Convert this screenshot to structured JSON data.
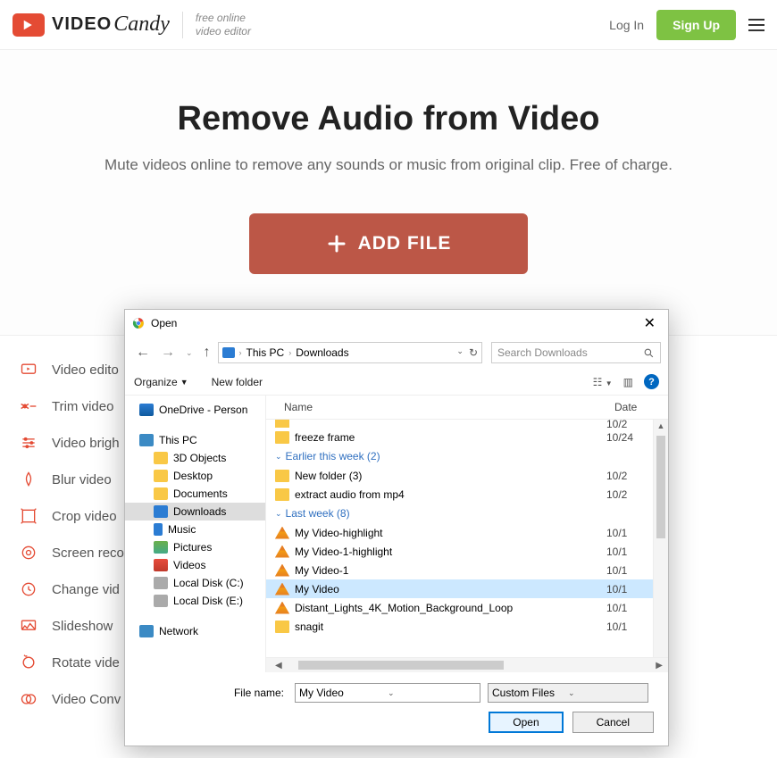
{
  "header": {
    "brand1": "VIDEO",
    "brand2": "Candy",
    "tagline1": "free online",
    "tagline2": "video editor",
    "login": "Log In",
    "signup": "Sign Up"
  },
  "hero": {
    "title": "Remove Audio from Video",
    "subtitle": "Mute videos online to remove any sounds or music from original clip. Free of charge.",
    "addfile": "ADD FILE"
  },
  "sidebar": [
    "Video edito",
    "Trim video",
    "Video brigh",
    "Blur video",
    "Crop video",
    "Screen reco",
    "Change vid",
    "Slideshow",
    "Rotate vide",
    "Video Conv"
  ],
  "dialog": {
    "title": "Open",
    "addr": {
      "root": "This PC",
      "folder": "Downloads"
    },
    "search_placeholder": "Search Downloads",
    "organize": "Organize",
    "newfolder": "New folder",
    "cols": {
      "name": "Name",
      "date": "Date"
    },
    "tree": [
      {
        "label": "OneDrive - Person",
        "cls": "l1",
        "ico": "ico-onedrive"
      },
      {
        "label": "This PC",
        "cls": "l1",
        "ico": "ico-pc"
      },
      {
        "label": "3D Objects",
        "cls": "l2",
        "ico": "ico-folder"
      },
      {
        "label": "Desktop",
        "cls": "l2",
        "ico": "ico-folder"
      },
      {
        "label": "Documents",
        "cls": "l2",
        "ico": "ico-folder"
      },
      {
        "label": "Downloads",
        "cls": "l2 sel",
        "ico": "ico-downloads"
      },
      {
        "label": "Music",
        "cls": "l2",
        "ico": "ico-music"
      },
      {
        "label": "Pictures",
        "cls": "l2",
        "ico": "ico-pics"
      },
      {
        "label": "Videos",
        "cls": "l2",
        "ico": "ico-videos"
      },
      {
        "label": "Local Disk (C:)",
        "cls": "l2",
        "ico": "ico-disk"
      },
      {
        "label": "Local Disk (E:)",
        "cls": "l2",
        "ico": "ico-disk"
      },
      {
        "label": "Network",
        "cls": "l1",
        "ico": "ico-network"
      }
    ],
    "cut_row": {
      "date": "10/2"
    },
    "rows0": [
      {
        "name": "freeze frame",
        "date": "10/24",
        "ico": "fl-folder"
      }
    ],
    "group1": "Earlier this week (2)",
    "rows1": [
      {
        "name": "New folder (3)",
        "date": "10/2",
        "ico": "fl-folder"
      },
      {
        "name": "extract audio from mp4",
        "date": "10/2",
        "ico": "fl-folder"
      }
    ],
    "group2": "Last week (8)",
    "rows2": [
      {
        "name": "My Video-highlight",
        "date": "10/1",
        "ico": "fl-vlc"
      },
      {
        "name": "My Video-1-highlight",
        "date": "10/1",
        "ico": "fl-vlc"
      },
      {
        "name": "My Video-1",
        "date": "10/1",
        "ico": "fl-vlc"
      },
      {
        "name": "My Video",
        "date": "10/1",
        "ico": "fl-vlc",
        "sel": true
      },
      {
        "name": "Distant_Lights_4K_Motion_Background_Loop",
        "date": "10/1",
        "ico": "fl-vlc"
      },
      {
        "name": "snagit",
        "date": "10/1",
        "ico": "fl-folder"
      }
    ],
    "filename_label": "File name:",
    "filename_value": "My Video",
    "filter": "Custom Files",
    "open": "Open",
    "cancel": "Cancel"
  }
}
